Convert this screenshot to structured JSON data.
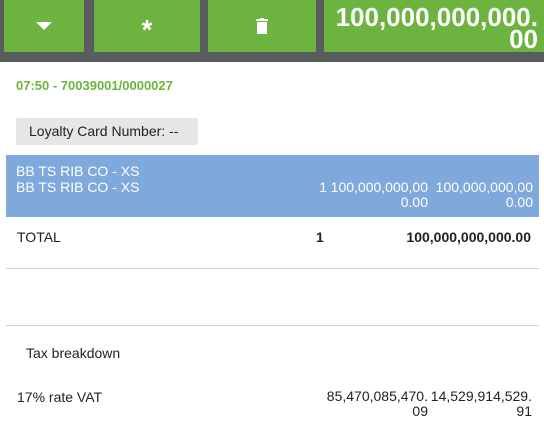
{
  "toolbar": {
    "grand_total": "100,000,000,000.00"
  },
  "receipt": {
    "header": "07:50 - 70039001/0000027",
    "loyalty_label": "Loyalty Card Number: --",
    "selected_line": {
      "name_1": "BB TS RIB CO - XS",
      "name_2": "BB TS RIB CO - XS",
      "qty": "1",
      "price": "100,000,000,000.00",
      "amount": "100,000,000,000.00"
    },
    "total": {
      "label": "TOTAL",
      "qty": "1",
      "amount": "100,000,000,000.00"
    }
  },
  "tax": {
    "title": "Tax breakdown",
    "rows": [
      {
        "name": "17% rate VAT",
        "base": "85,470,085,470.09",
        "amount": "14,529,914,529.91"
      }
    ]
  },
  "colors": {
    "accent": "#6cb33f",
    "selected": "#7fa8dc",
    "toolbar_bg": "#5a5d5f"
  }
}
